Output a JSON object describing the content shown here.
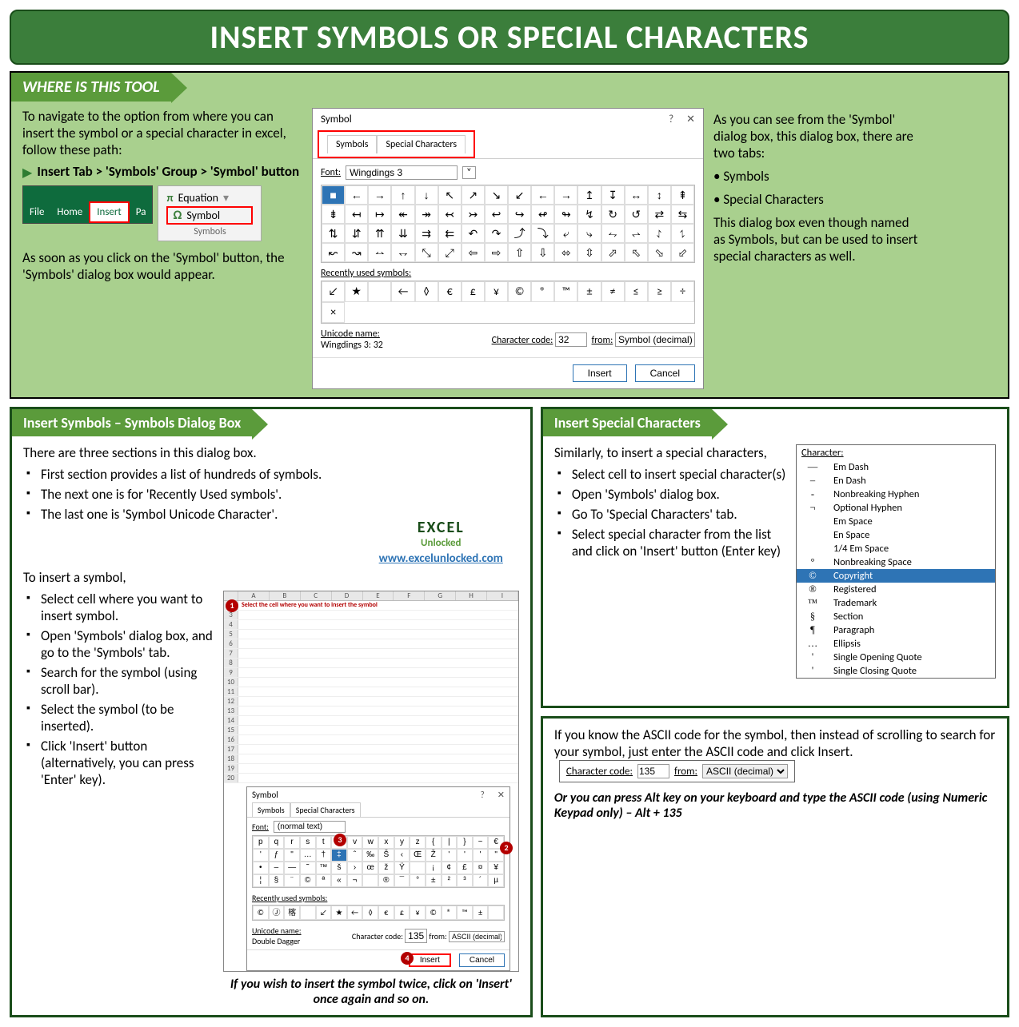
{
  "title": "INSERT SYMBOLS OR SPECIAL CHARACTERS",
  "top": {
    "heading": "WHERE IS THIS TOOL",
    "intro": "To navigate to the option from where you can insert the symbol or a special character in excel, follow these path:",
    "path": "Insert Tab > 'Symbols' Group > 'Symbol' button",
    "ribbon": {
      "file": "File",
      "home": "Home",
      "insert": "Insert",
      "pa": "Pa"
    },
    "group": {
      "equation": "Equation",
      "symbol": "Symbol",
      "label": "Symbols"
    },
    "after": "As soon as you click on the 'Symbol' button, the 'Symbols' dialog box would appear.",
    "right1": "As you can see from the 'Symbol' dialog box, this dialog box, there are two tabs:",
    "tab1": "Symbols",
    "tab2": "Special Characters",
    "right2": "This dialog box even though named as Symbols, but can be used to insert special characters as well."
  },
  "dialog": {
    "title": "Symbol",
    "tab_symbols": "Symbols",
    "tab_special": "Special Characters",
    "font_lbl": "Font:",
    "font_val": "Wingdings 3",
    "grid": [
      "■",
      "←",
      "→",
      "↑",
      "↓",
      "↖",
      "↗",
      "↘",
      "↙",
      "←",
      "→",
      "↥",
      "↧",
      "↔",
      "↕",
      "⇞",
      "⇟",
      "↤",
      "↦",
      "↞",
      "↠",
      "↢",
      "↣",
      "↩",
      "↪",
      "↫",
      "↬",
      "↯",
      "↻",
      "↺",
      "⇄",
      "⇆",
      "⇅",
      "⇵",
      "⇈",
      "⇊",
      "⇉",
      "⇇",
      "↶",
      "↷",
      "⤴",
      "⤵",
      "⤶",
      "⤷",
      "⥊",
      "⥋",
      "⥌",
      "⥍",
      "↜",
      "↝",
      "⥎",
      "⥐",
      "⤡",
      "⤢",
      "⇦",
      "⇨",
      "⇧",
      "⇩",
      "⬄",
      "⇳",
      "⬀",
      "⬁",
      "⬂",
      "⬃"
    ],
    "recent_lbl": "Recently used symbols:",
    "recent": [
      "↙",
      "★",
      "",
      "←",
      "◊",
      "€",
      "£",
      "¥",
      "©",
      "®",
      "™",
      "±",
      "≠",
      "≤",
      "≥",
      "÷",
      "×"
    ],
    "uni_lbl": "Unicode name:",
    "uni_name": "Wingdings 3: 32",
    "cc_lbl": "Character code:",
    "cc_val": "32",
    "from_lbl": "from:",
    "from_val": "Symbol (decimal)",
    "insert": "Insert",
    "cancel": "Cancel"
  },
  "left_panel": {
    "heading": "Insert Symbols – Symbols Dialog Box",
    "p1": "There are three sections in this dialog box.",
    "b1": "First section provides a list of hundreds of symbols.",
    "b2": "The next one is for 'Recently Used symbols'.",
    "b3": "The last one is 'Symbol Unicode Character'.",
    "p2": "To insert a symbol,",
    "s1": "Select cell where you want to insert symbol.",
    "s2": "Open 'Symbols' dialog box, and go to the 'Symbols' tab.",
    "s3": "Search for the symbol (using scroll bar).",
    "s4": "Select the symbol (to be inserted).",
    "s5": "Click 'Insert' button (alternatively, you can press 'Enter' key).",
    "brand1": "EXCEL",
    "brand2": "Unlocked",
    "url": "www.excelunlocked.com",
    "caption": "If you wish to insert the symbol twice, click on 'Insert' once again and so on."
  },
  "mini": {
    "title": "Symbol",
    "tab_symbols": "Symbols",
    "tab_special": "Special Characters",
    "font_lbl": "Font:",
    "font_val": "(normal text)",
    "instr": "Select the cell where you want to insert the symbol",
    "cols": [
      "",
      "A",
      "B",
      "C",
      "D",
      "E",
      "F",
      "G",
      "H",
      "I"
    ],
    "row1": [
      "p",
      "q",
      "r",
      "s",
      "t",
      "u",
      "v",
      "w",
      "x",
      "y",
      "z",
      "{",
      "|",
      "}",
      "~",
      "€"
    ],
    "row2": [
      "'",
      "ƒ",
      "\"",
      "…",
      "†",
      "‡",
      "ˆ",
      "‰",
      "Š",
      "‹",
      "Œ",
      "Ž",
      "'",
      "'",
      "'",
      "\""
    ],
    "row3": [
      "•",
      "–",
      "—",
      "˜",
      "™",
      "š",
      "›",
      "œ",
      "ž",
      "Ÿ",
      "",
      "¡",
      "¢",
      "£",
      "¤",
      "¥"
    ],
    "row4": [
      "¦",
      "§",
      "¨",
      "©",
      "ª",
      "«",
      "¬",
      "­",
      "®",
      "¯",
      "°",
      "±",
      "²",
      "³",
      "´",
      "µ"
    ],
    "recent_lbl": "Recently used symbols:",
    "recent": [
      "©",
      "Ⓙ",
      "楁",
      "",
      "↙",
      "★",
      "←",
      "◊",
      "€",
      "£",
      "¥",
      "©",
      "®",
      "™",
      "±",
      ""
    ],
    "uni_lbl": "Unicode name:",
    "uni_name": "Double Dagger",
    "cc_lbl": "Character code:",
    "cc_val": "135",
    "from_lbl": "from:",
    "from_val": "ASCII (decimal)",
    "insert": "Insert",
    "cancel": "Cancel"
  },
  "right_panel": {
    "heading": "Insert Special Characters",
    "p1": "Similarly, to insert a special characters,",
    "s1": "Select cell to insert special character(s)",
    "s2": "Open 'Symbols' dialog box.",
    "s3": "Go To 'Special Characters' tab.",
    "s4": "Select special character from the list and click on 'Insert' button (Enter key)",
    "list_hd": "Character:",
    "items": [
      {
        "s": "—",
        "n": "Em Dash"
      },
      {
        "s": "–",
        "n": "En Dash"
      },
      {
        "s": "-",
        "n": "Nonbreaking Hyphen"
      },
      {
        "s": "¬",
        "n": "Optional Hyphen"
      },
      {
        "s": "",
        "n": "Em Space"
      },
      {
        "s": "",
        "n": "En Space"
      },
      {
        "s": "",
        "n": "1/4 Em Space"
      },
      {
        "s": "°",
        "n": "Nonbreaking Space"
      },
      {
        "s": "©",
        "n": "Copyright",
        "sel": true
      },
      {
        "s": "®",
        "n": "Registered"
      },
      {
        "s": "™",
        "n": "Trademark"
      },
      {
        "s": "§",
        "n": "Section"
      },
      {
        "s": "¶",
        "n": "Paragraph"
      },
      {
        "s": "…",
        "n": "Ellipsis"
      },
      {
        "s": "'",
        "n": "Single Opening Quote"
      },
      {
        "s": "'",
        "n": "Single Closing Quote"
      }
    ]
  },
  "ascii_panel": {
    "p1": "If you know the ASCII code for the symbol, then instead of scrolling to search for your symbol, just enter the ASCII code and click Insert.",
    "cc_lbl": "Character code:",
    "cc_val": "135",
    "from_lbl": "from:",
    "from_val": "ASCII (decimal)",
    "p2": "Or you can press Alt key on your keyboard and type the ASCII code (using Numeric Keypad only) – Alt + 135"
  }
}
